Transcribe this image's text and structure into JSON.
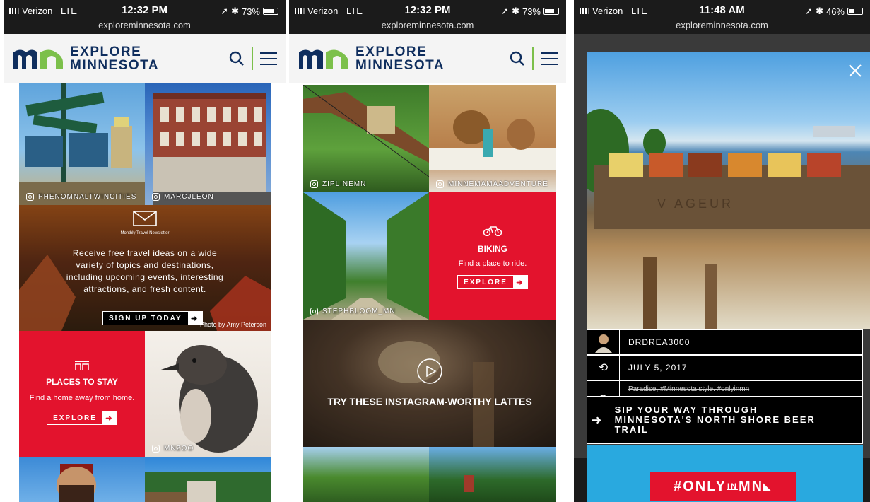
{
  "phone1": {
    "status": {
      "carrier": "Verizon",
      "network": "LTE",
      "time": "12:32 PM",
      "url": "exploreminnesota.com",
      "battery": "73%",
      "battery_level": 0.73
    },
    "brand": {
      "line1": "EXPLORE",
      "line2": "MINNESOTA",
      "mark": "mn"
    },
    "tiles": {
      "grand_rounds_tag": "PHENOMNALTWINCITIES",
      "building_tag": "MARCJLEON",
      "penguin_tag": "MNZOO"
    },
    "newsletter": {
      "label": "Monthly Travel Newsletter",
      "text": "Receive free travel ideas on a wide variety of topics and destinations, including upcoming events, interesting attractions, and fresh content.",
      "button": "SIGN UP TODAY",
      "credit": "Photo by Amy Peterson"
    },
    "places": {
      "title": "PLACES TO STAY",
      "text": "Find a home away from home.",
      "button": "EXPLORE"
    }
  },
  "phone2": {
    "status": {
      "carrier": "Verizon",
      "network": "LTE",
      "time": "12:32 PM",
      "url": "exploreminnesota.com",
      "battery": "73%",
      "battery_level": 0.73
    },
    "brand": {
      "line1": "EXPLORE",
      "line2": "MINNESOTA",
      "mark": "mn"
    },
    "tiles": {
      "zipline_tag": "ZIPLINEMN",
      "carousel_tag": "MINNEMAMAADVENTURE",
      "trees_tag": "STEPHBLOOM_MN"
    },
    "biking": {
      "title": "BIKING",
      "text": "Find a place to ride.",
      "button": "EXPLORE"
    },
    "video": {
      "title": "TRY THESE INSTAGRAM-WORTHY LATTES"
    }
  },
  "phone3": {
    "status": {
      "carrier": "Verizon",
      "network": "LTE",
      "time": "11:48 AM",
      "url": "exploreminnesota.com",
      "battery": "46%",
      "battery_level": 0.46
    },
    "photo": {
      "sign_text": "V    AGEUR"
    },
    "info": {
      "user": "DRDREA3000",
      "date": "JULY 5, 2017",
      "caption": "Paradise, #Minnesota style. #onlyinmn",
      "link": "SIP YOUR WAY THROUGH MINNESOTA'S NORTH SHORE BEER TRAIL"
    },
    "banner": {
      "text": "#ONLYINMN",
      "prefix": "#ONLY",
      "mid": "IN",
      "suffix": "MN"
    }
  },
  "colors": {
    "red": "#e3132d",
    "navy": "#0f2e5e",
    "green": "#7cc04b",
    "sky": "#29a9df"
  }
}
